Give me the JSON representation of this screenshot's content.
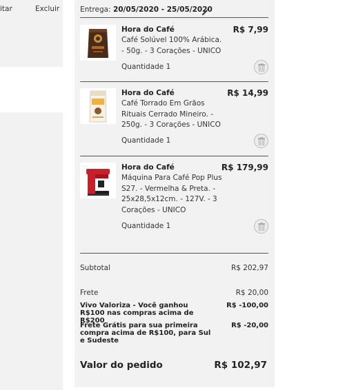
{
  "left": {
    "edit_label": "itar",
    "delete_label": "Excluir"
  },
  "delivery": {
    "label": "Entrega:",
    "dates": "20/05/2020 - 25/05/2020"
  },
  "items": [
    {
      "seller": "Hora do Café",
      "description": "Café Solúvel 100% Arábica. - 50g. - 3 Corações - UNICO",
      "price": "R$ 7,99",
      "quantity": "Quantidade 1",
      "image": "coffee-pouch-icon"
    },
    {
      "seller": "Hora do Café",
      "description": "Café Torrado Em Grãos Rituais Cerrado Mineiro. - 250g. - 3 Corações - UNICO",
      "price": "R$ 14,99",
      "quantity": "Quantidade 1",
      "image": "coffee-bag-icon"
    },
    {
      "seller": "Hora do Café",
      "description": "Máquina Para Café Pop Plus S27. - Vermelha & Preta. - 25x28,5x12cm. - 127V. - 3 Corações - UNICO",
      "price": "R$ 179,99",
      "quantity": "Quantidade 1",
      "image": "coffee-machine-icon"
    }
  ],
  "summary": {
    "subtotal_label": "Subtotal",
    "subtotal_value": "R$ 202,97",
    "shipping_label": "Frete",
    "shipping_value": "R$ 20,00",
    "discount1_label": "Vivo Valoriza - Você ganhou R$100 nas compras acima de R$200",
    "discount1_value": "R$ -100,00",
    "discount2_label": "Frete Grátis para sua primeira compra acima de R$100, para Sul e Sudeste",
    "discount2_value": "R$ -20,00",
    "total_label": "Valor do pedido",
    "total_value": "R$ 102,97"
  },
  "colors": {
    "panel_bg": "#f2f2f2",
    "text": "#222222",
    "machine_red": "#c8202a"
  }
}
